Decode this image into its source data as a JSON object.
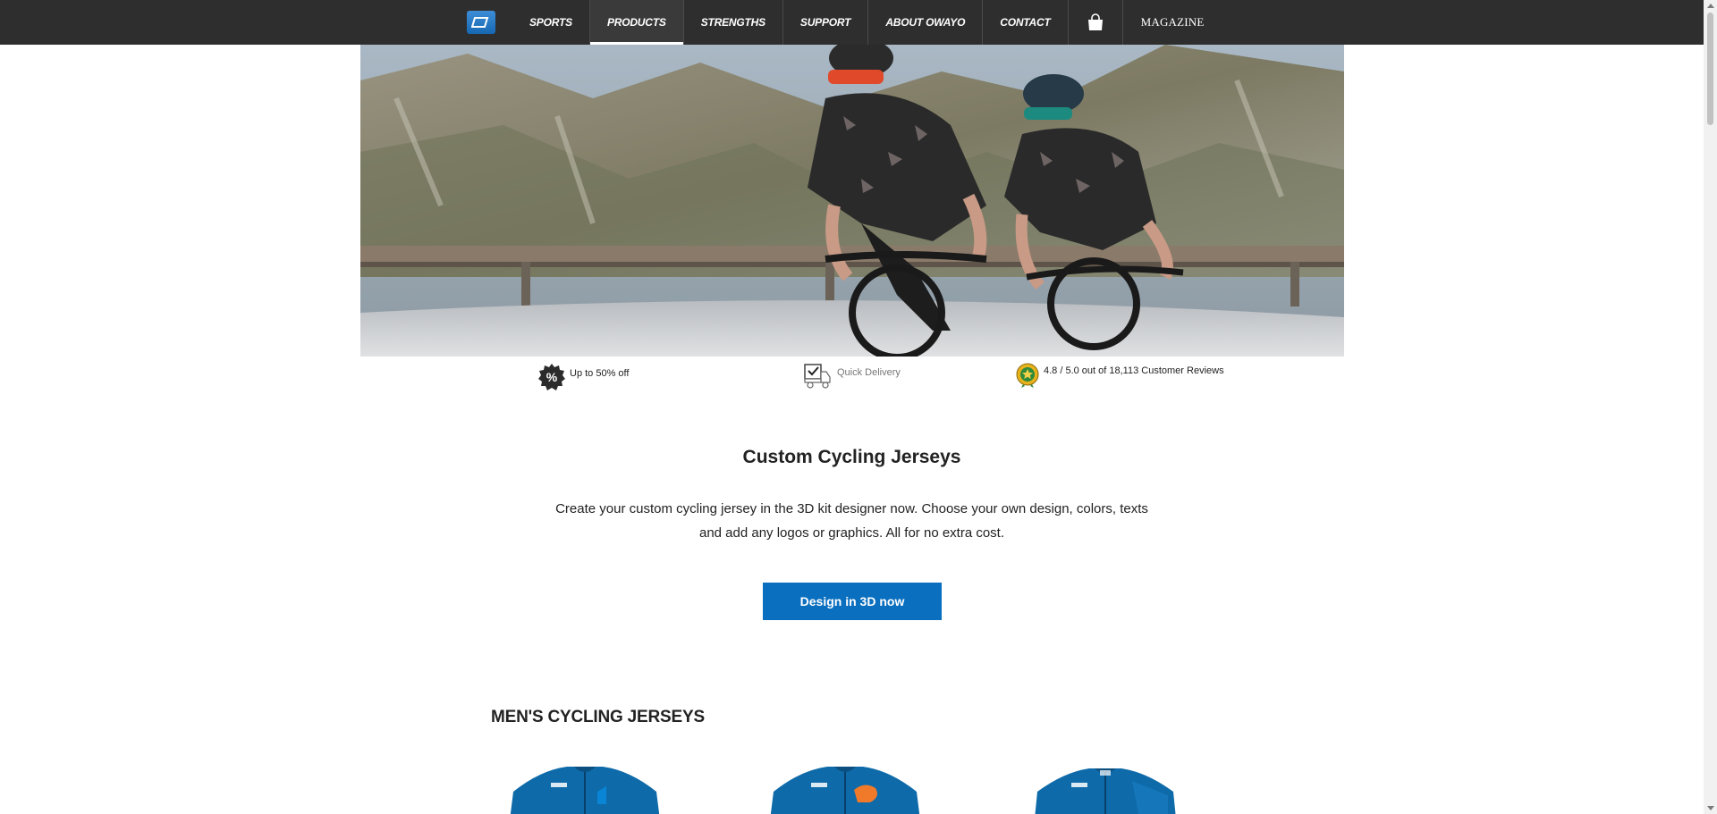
{
  "nav": {
    "items": [
      {
        "label": "SPORTS",
        "active": false
      },
      {
        "label": "PRODUCTS",
        "active": true
      },
      {
        "label": "STRENGTHS",
        "active": false
      },
      {
        "label": "SUPPORT",
        "active": false
      },
      {
        "label": "ABOUT OWAYO",
        "active": false
      },
      {
        "label": "CONTACT",
        "active": false
      }
    ],
    "cart_icon": "shopping-bag-icon",
    "magazine_label": "MAGAZINE"
  },
  "benefits": {
    "discount": "Up to 50% off",
    "delivery": "Quick Delivery",
    "reviews": "4.8 / 5.0 out of 18,113 Customer Reviews"
  },
  "intro": {
    "title": "Custom Cycling Jerseys",
    "text_line1": "Create your custom cycling jersey in the 3D kit designer now. Choose your own design, colors, texts",
    "text_line2": "and add any logos or graphics. All for no extra cost.",
    "cta_label": "Design in 3D now"
  },
  "section": {
    "title": "MEN'S CYCLING JERSEYS"
  },
  "colors": {
    "nav_bg": "#2e2e2e",
    "accent_blue": "#0a6fbf",
    "jersey_blue": "#0e6aa8",
    "jersey_orange": "#f07a2a"
  }
}
